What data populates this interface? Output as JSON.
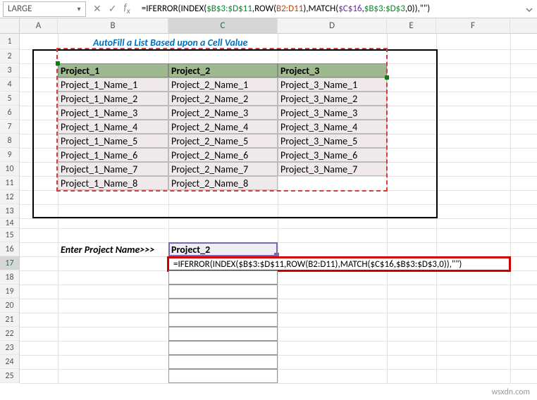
{
  "nameBox": "LARGE",
  "formula": {
    "full": "=IFERROR(INDEX($B$3:$D$11,ROW(B2:D11),MATCH($C$16,$B$3:$D$3,0)),\"\")",
    "prefix": "=IFERROR(INDEX(",
    "r1": "$B$3:$D$11",
    "mid1": ",ROW(",
    "r2": "B2:D11",
    "mid2": "),MATCH(",
    "r3": "$C$16",
    "mid3": ",",
    "r4": "$B$3:$D$3",
    "suffix": ",0)),\"\")"
  },
  "columns": [
    "A",
    "B",
    "C",
    "D",
    "E",
    "F"
  ],
  "title": "AutoFill a List Based upon a Cell Value",
  "headers": [
    "Project_1",
    "Project_2",
    "Project_3"
  ],
  "table": [
    [
      "Project_1_Name_1",
      "Project_2_Name_1",
      "Project_3_Name_1"
    ],
    [
      "Project_1_Name_2",
      "Project_2_Name_2",
      "Project_3_Name_2"
    ],
    [
      "Project_1_Name_3",
      "Project_2_Name_3",
      "Project_3_Name_3"
    ],
    [
      "Project_1_Name_4",
      "Project_2_Name_4",
      "Project_3_Name_4"
    ],
    [
      "Project_1_Name_5",
      "Project_2_Name_5",
      "Project_3_Name_5"
    ],
    [
      "Project_1_Name_6",
      "Project_2_Name_6",
      "Project_3_Name_6"
    ],
    [
      "Project_1_Name_7",
      "Project_2_Name_7",
      "Project_3_Name_7"
    ],
    [
      "Project_1_Name_8",
      "Project_2_Name_8",
      ""
    ]
  ],
  "enterLabel": "Enter Project Name>>>",
  "enterValue": "Project_2",
  "watermark": "wsxdn.com",
  "rows": [
    "1",
    "2",
    "3",
    "4",
    "5",
    "6",
    "7",
    "8",
    "9",
    "10",
    "11",
    "12",
    "13",
    "14",
    "15",
    "16",
    "17",
    "18",
    "19",
    "20",
    "21",
    "22",
    "23",
    "24",
    "25"
  ]
}
